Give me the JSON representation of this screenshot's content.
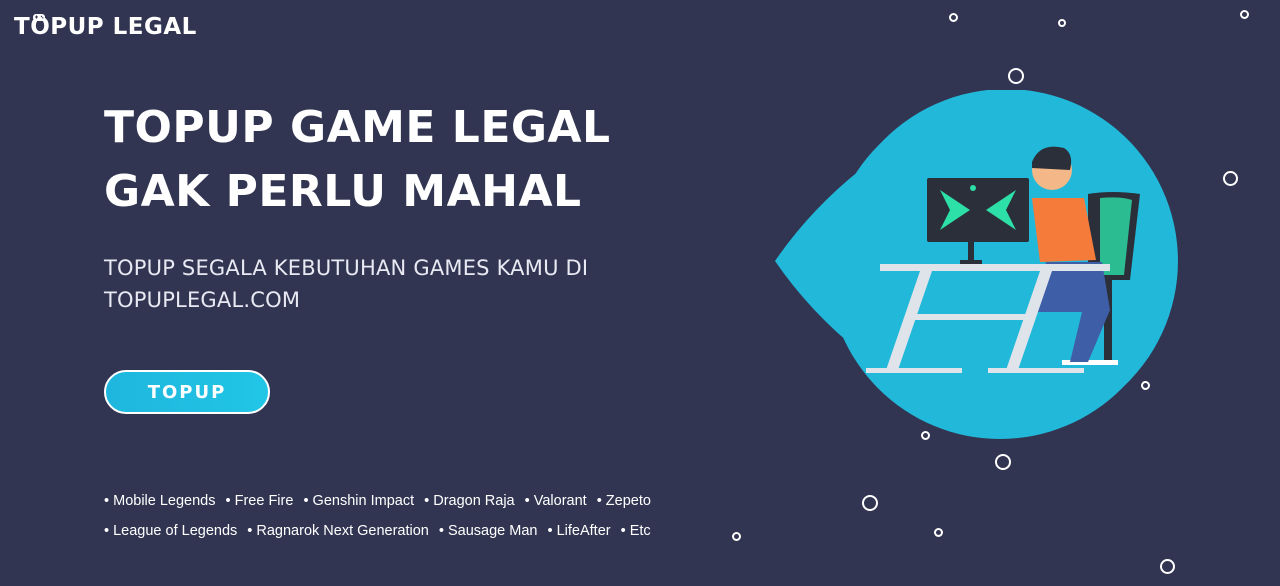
{
  "brand": {
    "logo_text": "TOPUP LEGAL"
  },
  "hero": {
    "headline_line1": "TOPUP GAME LEGAL",
    "headline_line2": "GAK PERLU MAHAL",
    "subline_line1": "TOPUP SEGALA KEBUTUHAN GAMES KAMU DI",
    "subline_line2": "TOPUPLEGAL.COM",
    "cta_label": "TOPUP"
  },
  "games": {
    "row1": [
      "Mobile Legends",
      "Free Fire",
      "Genshin Impact",
      "Dragon Raja",
      "Valorant",
      "Zepeto"
    ],
    "row2": [
      "League of Legends",
      "Ragnarok Next Generation",
      "Sausage Man",
      "LifeAfter",
      "Etc"
    ]
  },
  "colors": {
    "background": "#323552",
    "accent": "#21c6e6",
    "character_shirt": "#f47b3a",
    "monitor_glow": "#2de0a7"
  },
  "icons": [
    "gamepad-icon",
    "gamer-illustration"
  ]
}
